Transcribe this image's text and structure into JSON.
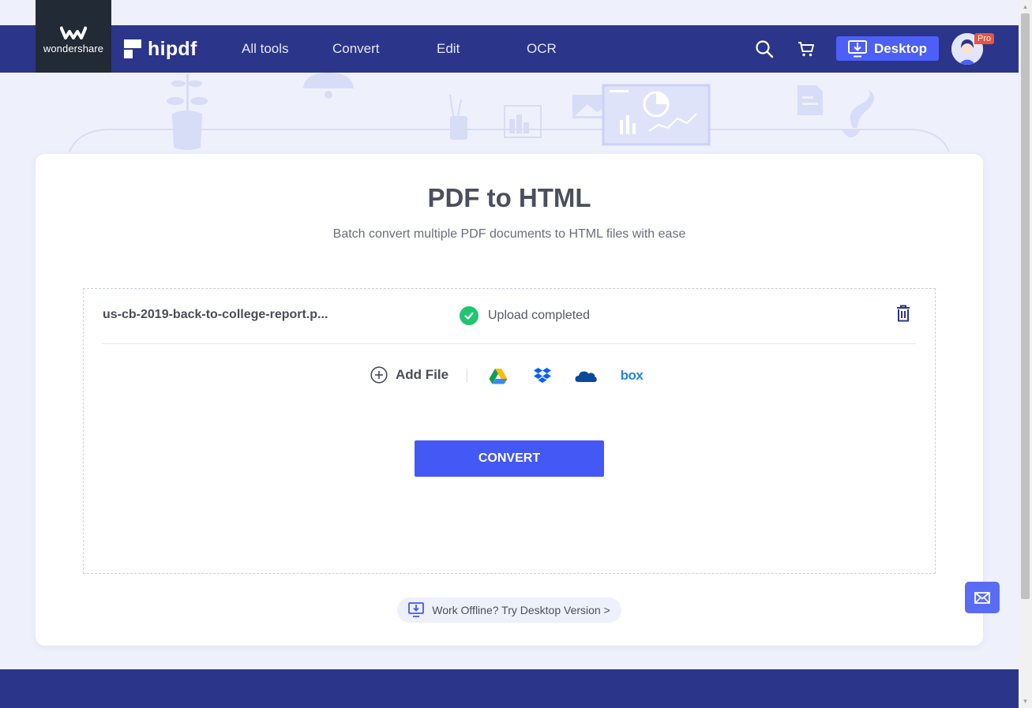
{
  "brand": {
    "company": "wondershare",
    "product": "hipdf"
  },
  "nav": {
    "items": [
      "All tools",
      "Convert",
      "Edit",
      "OCR"
    ]
  },
  "header": {
    "desktop_label": "Desktop",
    "pro_badge": "Pro"
  },
  "page": {
    "title": "PDF to HTML",
    "subtitle": "Batch convert multiple PDF documents to HTML files with ease"
  },
  "upload": {
    "file_name": "us-cb-2019-back-to-college-report.p...",
    "status": "Upload completed",
    "add_file_label": "Add File",
    "cloud_sources": [
      "google-drive-icon",
      "dropbox-icon",
      "onedrive-icon",
      "box-icon"
    ],
    "box_label": "box"
  },
  "convert_label": "CONVERT",
  "offline_link": "Work Offline? Try Desktop Version >",
  "colors": {
    "nav_bg": "#2b3589",
    "accent": "#4458f5",
    "success": "#22c56f",
    "page_bg": "#eef0fb",
    "pro_badge": "#e9543d"
  }
}
